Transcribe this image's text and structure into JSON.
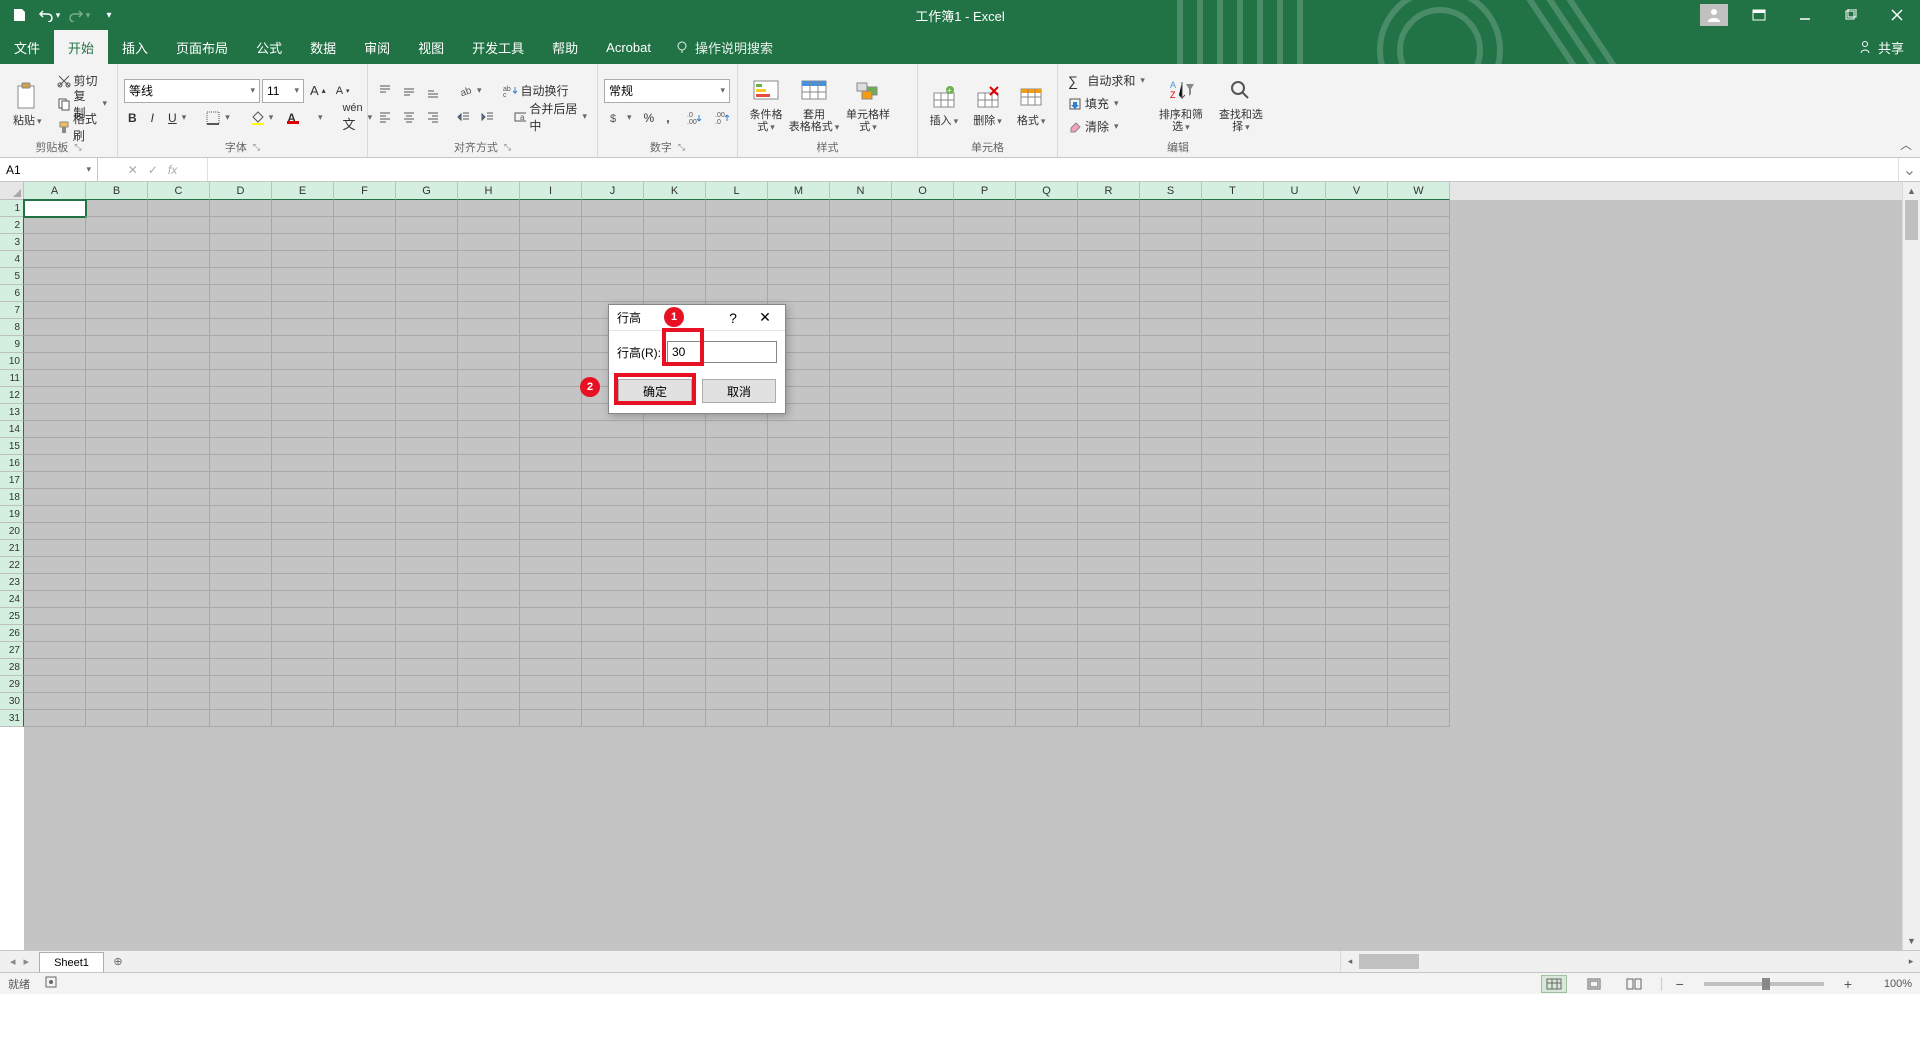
{
  "titlebar": {
    "title": "工作簿1 - Excel"
  },
  "tabs": {
    "items": [
      "文件",
      "开始",
      "插入",
      "页面布局",
      "公式",
      "数据",
      "审阅",
      "视图",
      "开发工具",
      "帮助",
      "Acrobat"
    ],
    "active_index": 1,
    "tell_me": "操作说明搜索",
    "share": "共享"
  },
  "ribbon": {
    "clipboard": {
      "paste": "粘贴",
      "cut": "剪切",
      "copy": "复制",
      "format_painter": "格式刷",
      "title": "剪贴板"
    },
    "font": {
      "name": "等线",
      "size": "11",
      "title": "字体"
    },
    "align": {
      "wrap": "自动换行",
      "merge": "合并后居中",
      "title": "对齐方式"
    },
    "number": {
      "format": "常规",
      "title": "数字"
    },
    "styles": {
      "cond": "条件格式",
      "table": "套用\n表格格式",
      "cell": "单元格样式",
      "title": "样式"
    },
    "cells": {
      "insert": "插入",
      "delete": "删除",
      "format": "格式",
      "title": "单元格"
    },
    "editing": {
      "sum": "自动求和",
      "fill": "填充",
      "clear": "清除",
      "sort": "排序和筛选",
      "find": "查找和选择",
      "title": "编辑"
    }
  },
  "fbar": {
    "name": "A1",
    "fx": "fx"
  },
  "columns": [
    "A",
    "B",
    "C",
    "D",
    "E",
    "F",
    "G",
    "H",
    "I",
    "J",
    "K",
    "L",
    "M",
    "N",
    "O",
    "P",
    "Q",
    "R",
    "S",
    "T",
    "U",
    "V",
    "W"
  ],
  "rows": 31,
  "sheet": {
    "name": "Sheet1"
  },
  "status": {
    "ready": "就绪",
    "zoom": "100%"
  },
  "dialog": {
    "title": "行高",
    "label": "行高(R):",
    "value": "30",
    "ok": "确定",
    "cancel": "取消"
  },
  "annot": {
    "n1": "1",
    "n2": "2"
  }
}
